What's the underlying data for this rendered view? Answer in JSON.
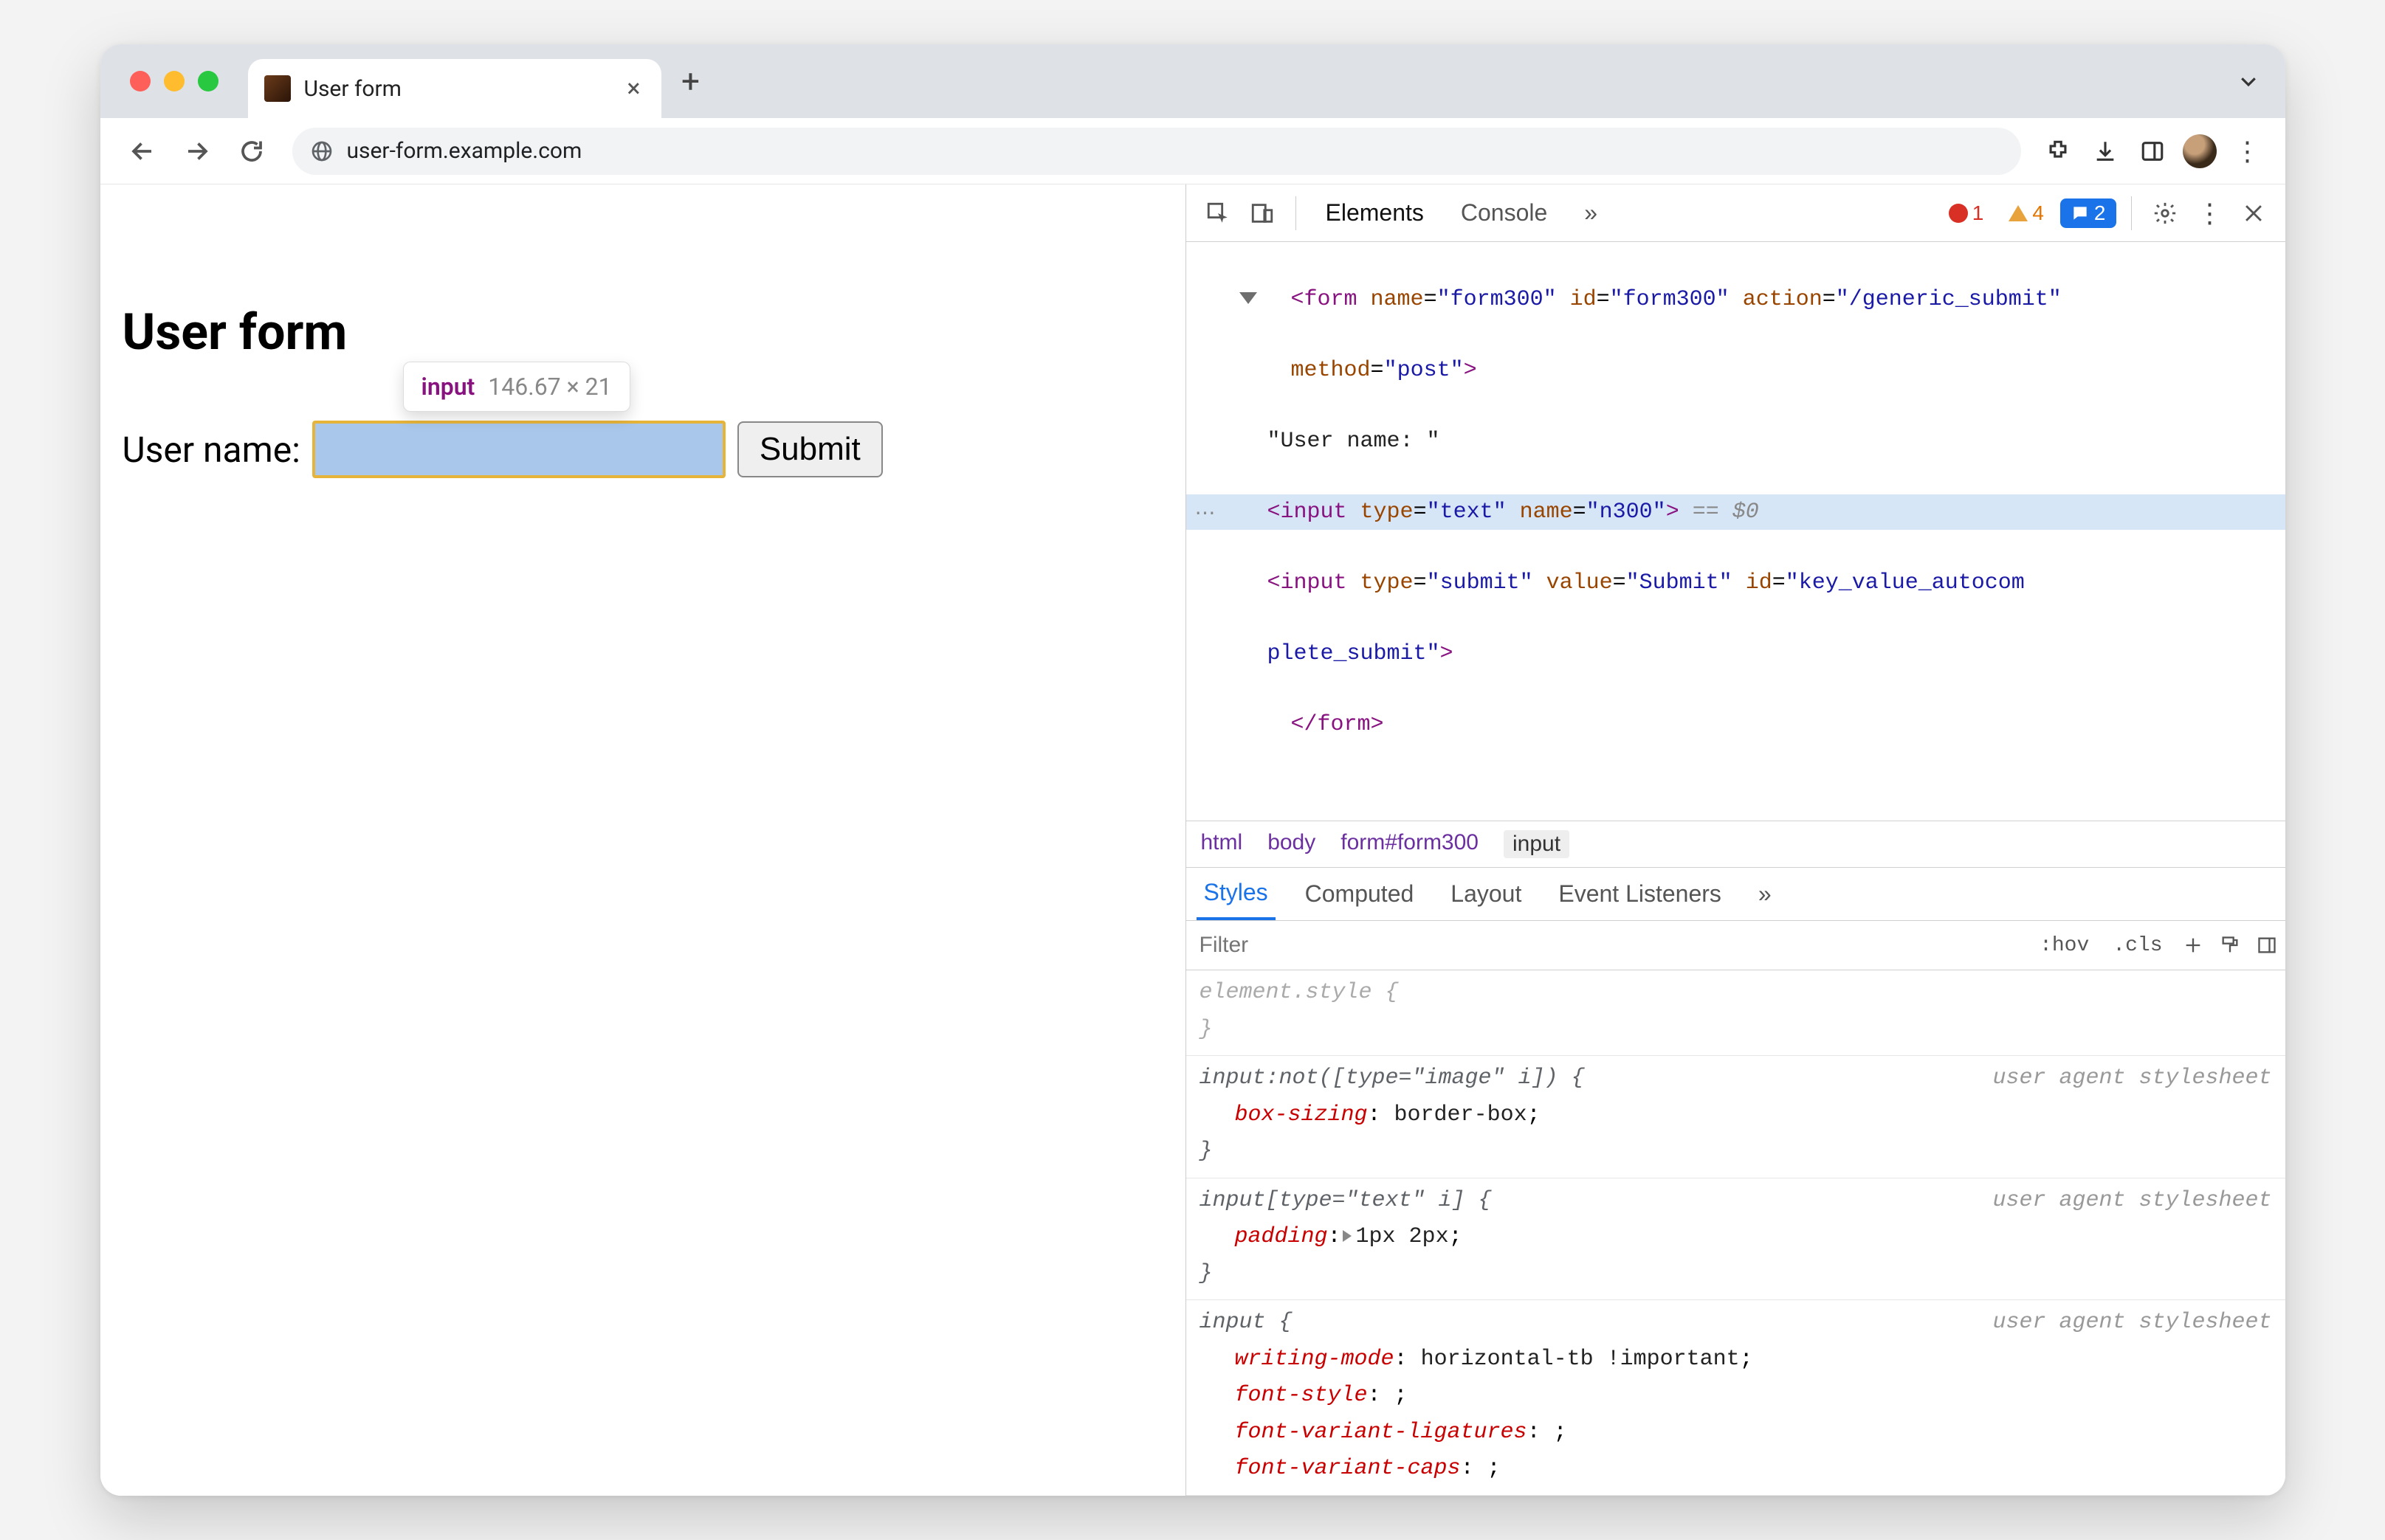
{
  "browser": {
    "tab_title": "User form",
    "url": "user-form.example.com"
  },
  "page": {
    "heading": "User form",
    "label": "User name:",
    "submit": "Submit"
  },
  "inspect_tooltip": {
    "tag": "input",
    "dims": "146.67 × 21"
  },
  "devtools": {
    "tabs": {
      "elements": "Elements",
      "console": "Console"
    },
    "overflow": "»",
    "badges": {
      "errors": "1",
      "warnings": "4",
      "issues": "2"
    },
    "dom": {
      "form_open_1": "<form name=\"form300\" id=\"form300\" action=\"/generic_submit\"",
      "form_open_2": "method=\"post\">",
      "text_node": "\"User name: \"",
      "input_sel": "<input type=\"text\" name=\"n300\">",
      "sel_suffix": " == $0",
      "submit_1": "<input type=\"submit\" value=\"Submit\" id=\"key_value_autocom",
      "submit_2": "plete_submit\">",
      "form_close": "</form>"
    },
    "crumbs": {
      "c0": "html",
      "c1": "body",
      "c2": "form#form300",
      "c3": "input"
    },
    "styles_tabs": {
      "styles": "Styles",
      "computed": "Computed",
      "layout": "Layout",
      "listeners": "Event Listeners",
      "overflow": "»"
    },
    "styles_filter": {
      "placeholder": "Filter",
      "hov": ":hov",
      "cls": ".cls"
    },
    "rules": {
      "ua_label": "user agent stylesheet",
      "r0_sel": "element.style {",
      "r0_close": "}",
      "r1_sel": "input:not([type=\"image\" i]) {",
      "r1_p1_name": "box-sizing",
      "r1_p1_val": "border-box",
      "r1_close": "}",
      "r2_sel": "input[type=\"text\" i] {",
      "r2_p1_name": "padding",
      "r2_p1_val": "1px 2px",
      "r2_close": "}",
      "r3_sel": "input {",
      "r3_p1_name": "writing-mode",
      "r3_p1_val": "horizontal-tb !important",
      "r3_p2_name": "font-style",
      "r3_p3_name": "font-variant-ligatures",
      "r3_p4_name": "font-variant-caps"
    }
  }
}
